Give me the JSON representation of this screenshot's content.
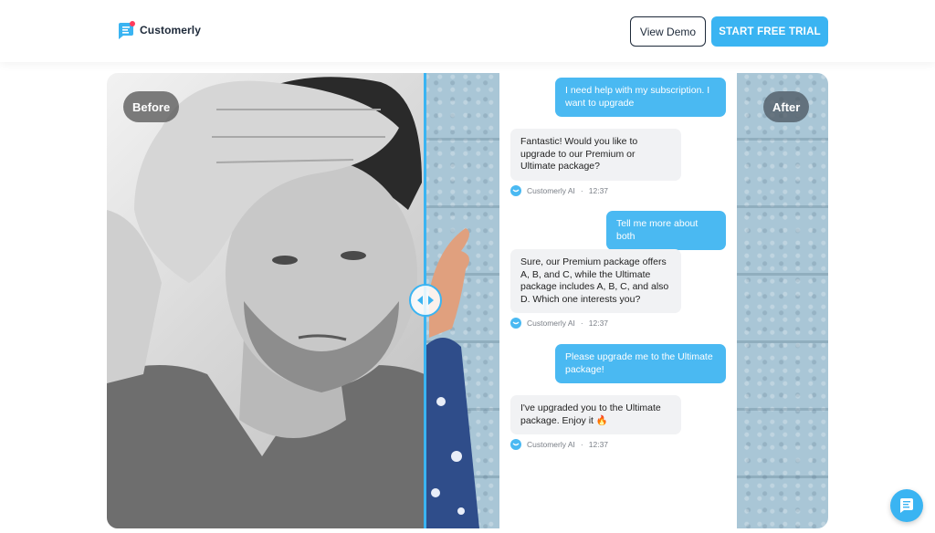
{
  "header": {
    "brand": "Customerly",
    "demo_label": "View Demo",
    "trial_label": "START FREE TRIAL"
  },
  "showcase": {
    "before_label": "Before",
    "after_label": "After"
  },
  "chat": {
    "messages": [
      {
        "from": "user",
        "text": "I need help with my subscription. I want to upgrade"
      },
      {
        "from": "ai",
        "text": "Fantastic! Would you like to upgrade to our Premium or Ultimate package?",
        "sender": "Customerly AI",
        "time": "12:37"
      },
      {
        "from": "user",
        "text": "Tell me more about both"
      },
      {
        "from": "ai",
        "text": "Sure, our Premium package offers A, B, and C, while the Ultimate package includes A, B, C, and also D. Which one interests you?",
        "sender": "Customerly AI",
        "time": "12:37"
      },
      {
        "from": "user",
        "text": "Please upgrade me to the Ultimate package!"
      },
      {
        "from": "ai",
        "text": "I've upgraded you to the Ultimate package. Enjoy it 🔥",
        "sender": "Customerly AI",
        "time": "12:37"
      }
    ],
    "separator": "·"
  },
  "icons": {
    "logo": "chat-bubble-logo-icon",
    "divider": "left-right-arrows-icon",
    "launcher": "chat-launcher-icon"
  },
  "colors": {
    "accent": "#3ab4f2",
    "dark": "#1d2939",
    "user_bubble": "#4ab9f2",
    "ai_bubble": "#f1f2f4"
  }
}
